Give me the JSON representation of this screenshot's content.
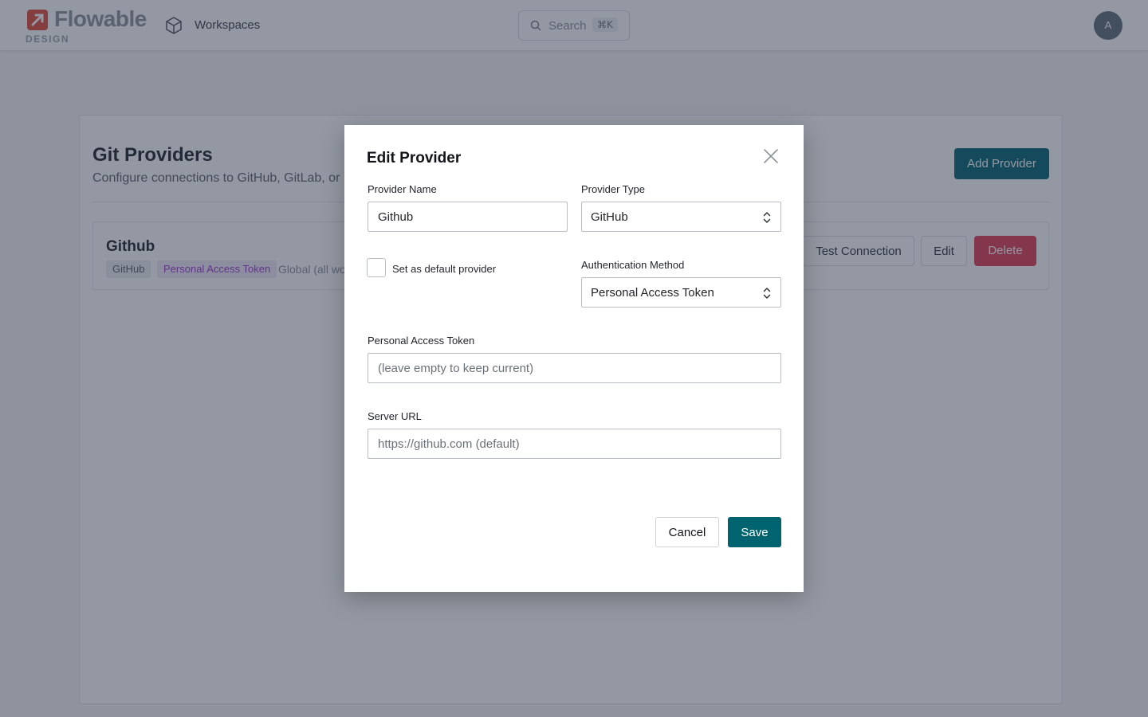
{
  "header": {
    "logo_word": "Flowable",
    "logo_sub": "DESIGN",
    "workspaces_label": "Workspaces",
    "search_placeholder": "Search",
    "search_shortcut": "⌘K",
    "avatar_initial": "A"
  },
  "page": {
    "title": "Git Providers",
    "subtitle": "Configure connections to GitHub, GitLab, or",
    "add_button": "Add Provider"
  },
  "provider": {
    "name": "Github",
    "type_badge": "GitHub",
    "auth_badge": "Personal Access Token",
    "scope": "Global (all wo",
    "test_button": "Test Connection",
    "edit_button": "Edit",
    "delete_button": "Delete"
  },
  "modal": {
    "title": "Edit Provider",
    "provider_name_label": "Provider Name",
    "provider_name_value": "Github",
    "provider_type_label": "Provider Type",
    "provider_type_value": "GitHub",
    "default_label": "Set as default provider",
    "default_checked": false,
    "auth_method_label": "Authentication Method",
    "auth_method_value": "Personal Access Token",
    "token_label": "Personal Access Token",
    "token_placeholder": "(leave empty to keep current)",
    "server_url_label": "Server URL",
    "server_url_placeholder": "https://github.com (default)",
    "cancel_button": "Cancel",
    "save_button": "Save"
  },
  "colors": {
    "primary": "#006370",
    "danger": "#e03a52",
    "logo": "#e14a38",
    "auth_badge_text": "#9b38c9"
  }
}
